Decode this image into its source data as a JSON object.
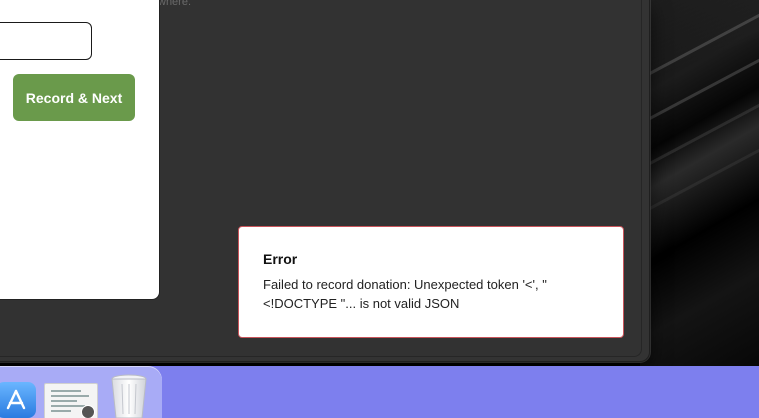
{
  "background_text": "where.",
  "form": {
    "input_value": "",
    "record_button_label": "Record & Next"
  },
  "toast": {
    "title": "Error",
    "message_line1": "Failed to record donation: Unexpected token '<', \"",
    "message_line2": "<!DOCTYPE \"... is not valid JSON"
  },
  "dock": {
    "items": [
      "app-store-icon",
      "preview-document-icon",
      "trash-icon"
    ]
  },
  "colors": {
    "accent_green": "#6a9a4b",
    "error_border": "#c9545a",
    "dock_background": "#7d7fee",
    "overlay": "#333333"
  }
}
